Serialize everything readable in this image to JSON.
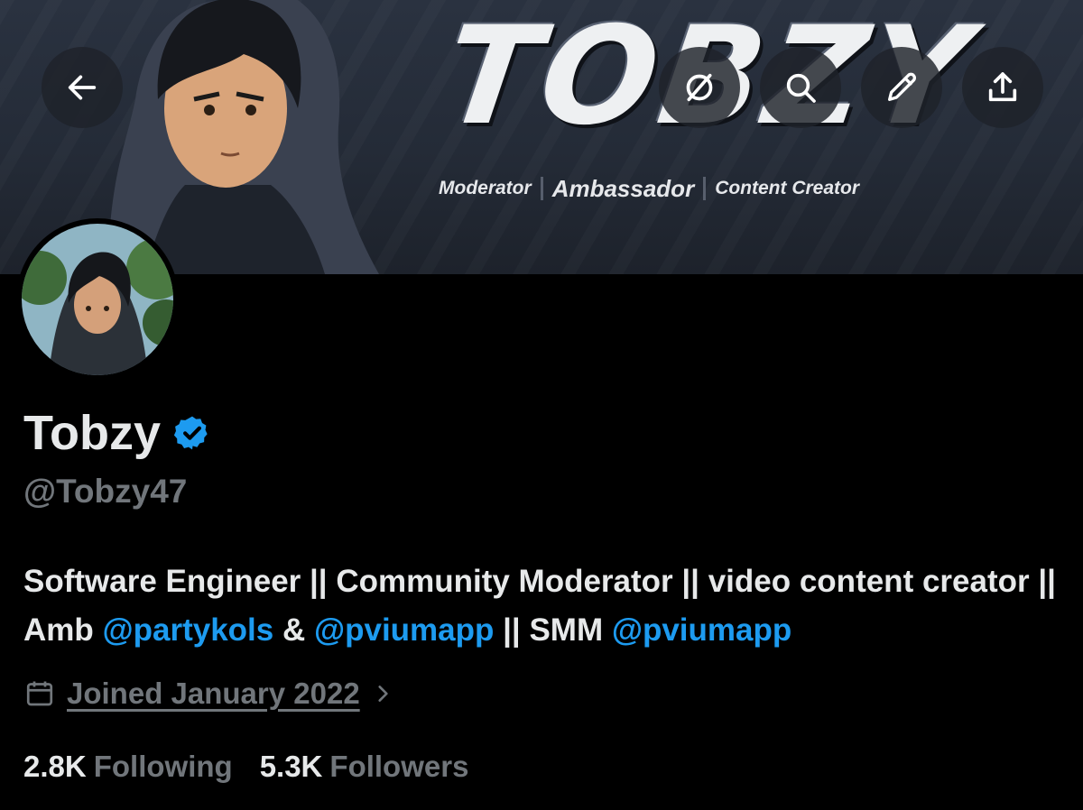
{
  "banner": {
    "brand": "TOBZY",
    "tagline": [
      "Moderator",
      "Ambassador",
      "Content Creator"
    ]
  },
  "toolbar": {
    "back": "arrow-left-icon",
    "grok": "grok-icon",
    "search": "search-icon",
    "edit": "pencil-icon",
    "share": "share-icon"
  },
  "profile": {
    "name": "Tobzy",
    "handle": "@Tobzy47",
    "bio": {
      "p1": "Software Engineer || Community Moderator || video content creator || Amb ",
      "m1": "@partykols",
      "p2": " & ",
      "m2": "@pviumapp",
      "p3": " || SMM ",
      "m3": "@pviumapp"
    },
    "joined": "Joined January 2022",
    "following_count": "2.8K",
    "following_label": "Following",
    "followers_count": "5.3K",
    "followers_label": "Followers"
  },
  "colors": {
    "accent": "#1d9bf0",
    "muted": "#71767b",
    "text": "#e7e9ea",
    "background": "#000000"
  }
}
